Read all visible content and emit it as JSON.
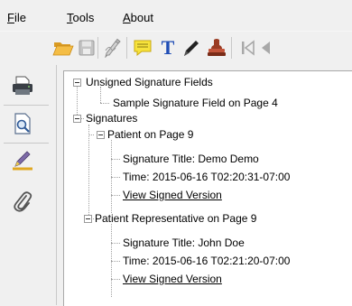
{
  "menu": {
    "file": {
      "label": "File",
      "mnemonic": "F",
      "rest": "ile"
    },
    "tools": {
      "label": "Tools",
      "mnemonic": "T",
      "rest": "ools"
    },
    "about": {
      "label": "About",
      "mnemonic": "A",
      "rest": "bout"
    }
  },
  "toolbar": {
    "icons": [
      "open-folder-icon",
      "save-icon",
      "sign-pen-icon",
      "comment-icon",
      "text-icon",
      "ink-pen-icon",
      "stamp-icon",
      "first-page-icon",
      "previous-page-icon"
    ],
    "text_tool_glyph": "T"
  },
  "sidebar": {
    "icons": [
      "print-icon",
      "preview-icon",
      "highlight-icon",
      "attachment-icon"
    ]
  },
  "tree": {
    "unsigned": {
      "label": "Unsigned Signature Fields",
      "children": [
        "Sample Signature Field on Page 4"
      ]
    },
    "signatures": {
      "label": "Signatures",
      "items": [
        {
          "label": "Patient on Page 9",
          "title": "Signature Title: Demo Demo",
          "time": "Time: 2015-06-16 T02:20:31-07:00",
          "link": "View Signed Version"
        },
        {
          "label": "Patient Representative on Page 9",
          "title": "Signature Title: John Doe",
          "time": "Time: 2015-06-16 T02:21:20-07:00",
          "link": "View Signed Version"
        }
      ]
    }
  },
  "colors": {
    "folder": "#f0b93b",
    "note": "#f5e23b",
    "text_tool": "#1f4db5",
    "stamp": "#b0452a",
    "nav_disabled": "#a8a8a8"
  }
}
